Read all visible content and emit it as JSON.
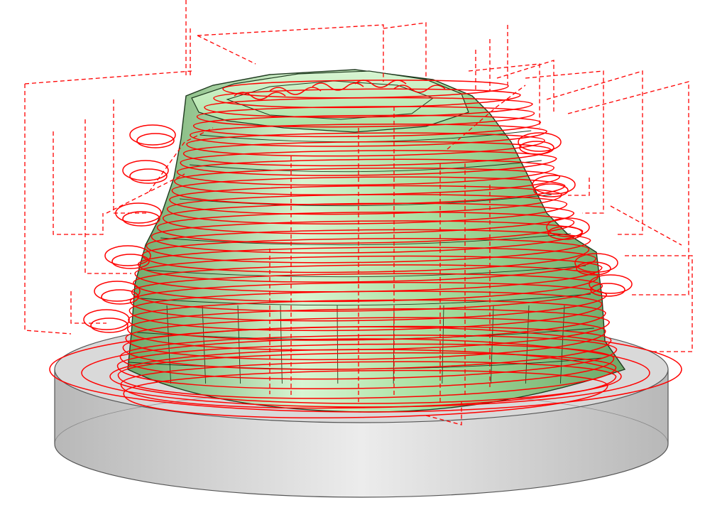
{
  "viewport": {
    "background": "#ffffff",
    "view_mode": "shaded-with-toolpath"
  },
  "stock": {
    "shape": "cylinder",
    "fill_top": "#d9d9d9",
    "fill_side_light": "#ececec",
    "fill_side_dark": "#b8b8b8",
    "edge_color": "#555555"
  },
  "model": {
    "fill_light": "#d8f5d2",
    "fill_mid": "#a9e0a1",
    "fill_dark": "#6da869",
    "edge_color": "#1f3a1f"
  },
  "toolpath": {
    "cutting_color": "#ff0000",
    "rapid_color": "#ff0000",
    "cutting_style": "solid",
    "rapid_style": "dashed"
  }
}
